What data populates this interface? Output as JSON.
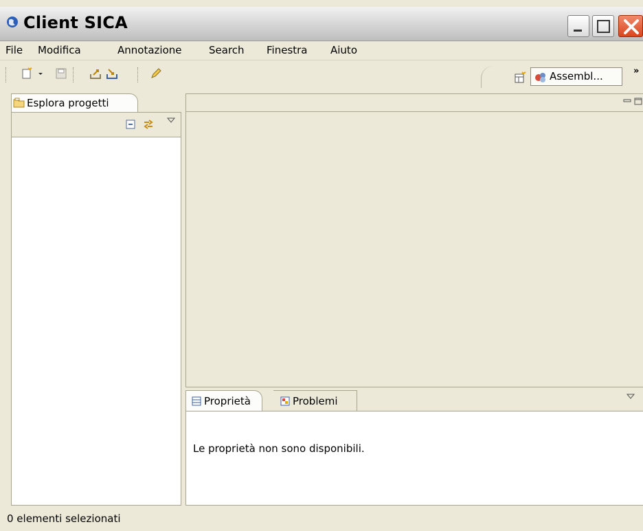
{
  "window": {
    "title": "Client SICA",
    "app_icon": "globe-icon"
  },
  "menu": [
    "File",
    "Modifica",
    "Annotazione",
    "Search",
    "Finestra",
    "Aiuto"
  ],
  "toolbar": {
    "icons": [
      "new-icon",
      "dropdown-arrow-icon",
      "save-icon",
      "export-icon",
      "import-icon",
      "pencil-icon"
    ],
    "perspective_label": "Assembl...",
    "overflow_label": "»"
  },
  "left_view": {
    "tab_label": "Esplora progetti"
  },
  "bottom_view": {
    "tabs": [
      {
        "label": "Proprietà"
      },
      {
        "label": "Problemi"
      }
    ],
    "message": "Le proprietà non sono disponibili."
  },
  "status": {
    "text": "0 elementi selezionati"
  }
}
